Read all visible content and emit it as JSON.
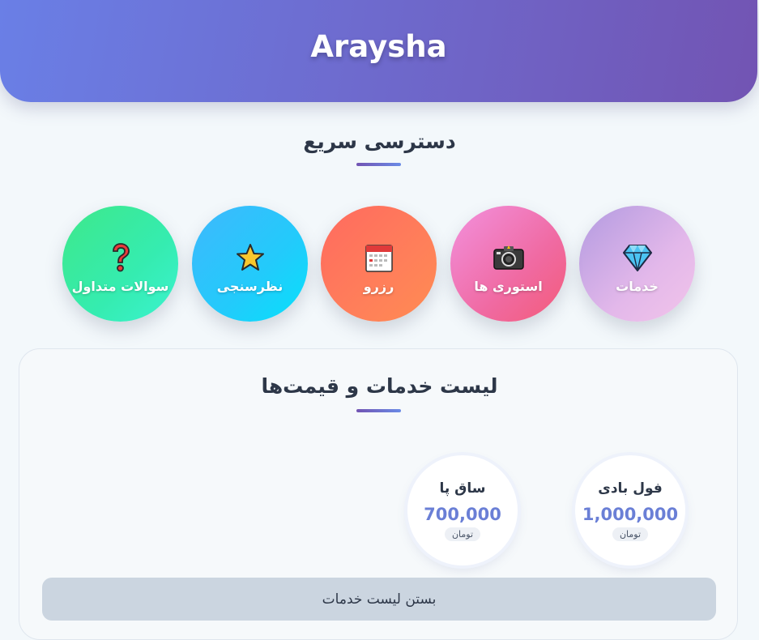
{
  "app": {
    "title": "Araysha"
  },
  "quick_access": {
    "title": "دسترسی سریع",
    "items": [
      {
        "label": "خدمات",
        "icon": "diamond-icon"
      },
      {
        "label": "استوری ها",
        "icon": "camera-icon"
      },
      {
        "label": "رزرو",
        "icon": "calendar-icon"
      },
      {
        "label": "نظرسنجی",
        "icon": "star-icon"
      },
      {
        "label": "سوالات متداول",
        "icon": "question-icon"
      }
    ]
  },
  "services": {
    "title": "لیست خدمات و قیمت‌ها",
    "items": [
      {
        "name": "فول بادی",
        "price": "1,000,000",
        "currency": "تومان"
      },
      {
        "name": "ساق پا",
        "price": "700,000",
        "currency": "تومان"
      }
    ],
    "close_label": "بستن لیست خدمات"
  }
}
